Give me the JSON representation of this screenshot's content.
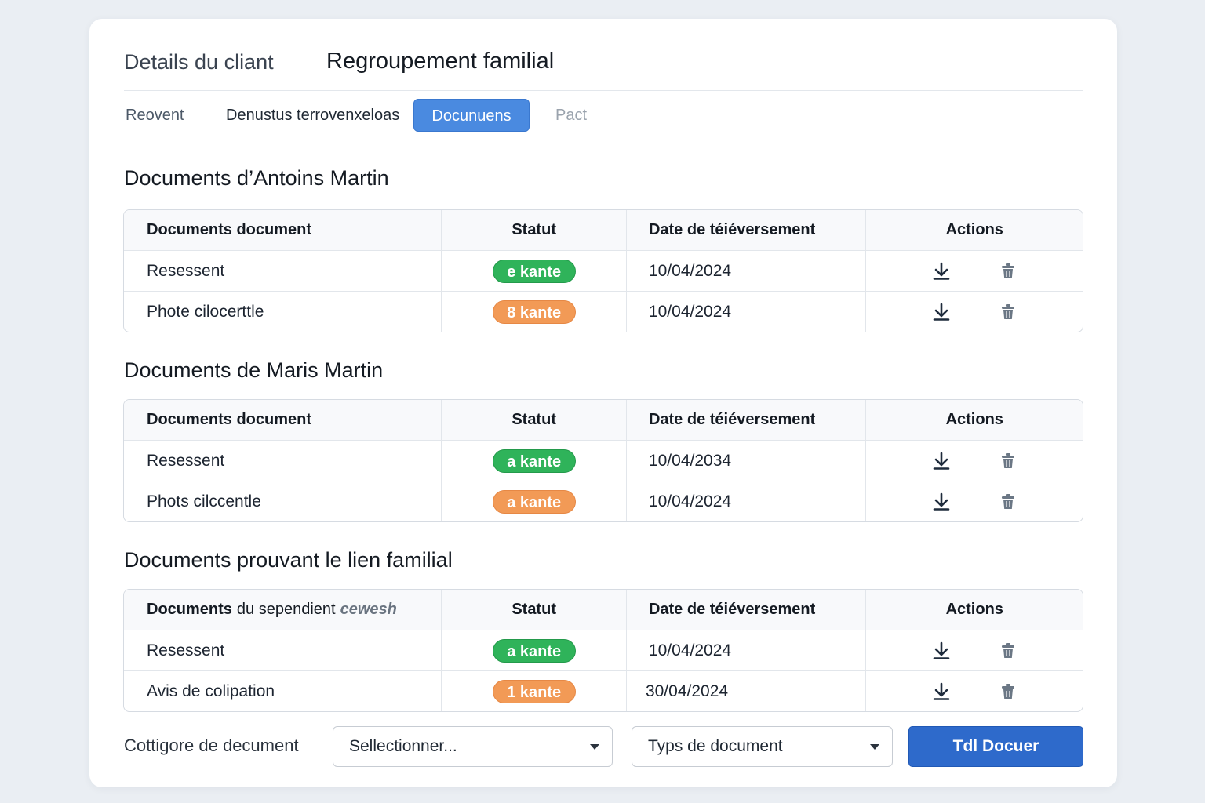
{
  "header": {
    "crumb": "Details du cliant",
    "title": "Regroupement familial"
  },
  "tabs": [
    {
      "label": "Reovent"
    },
    {
      "label": "Denustus terrovenxeloas"
    },
    {
      "label": "Docunuens",
      "active": true
    },
    {
      "label": "Pact"
    }
  ],
  "columns": {
    "document": "Documents document",
    "status": "Statut",
    "date": "Date de téiéversement",
    "actions": "Actions"
  },
  "sections": [
    {
      "title": "Documents d’Antoins Martin",
      "rows": [
        {
          "name": "Resessent",
          "status": "e kante",
          "status_color": "green",
          "date": "10/04/2024"
        },
        {
          "name": "Phote cilocerttle",
          "status": "8 kante",
          "status_color": "orange",
          "date": "10/04/2024"
        }
      ]
    },
    {
      "title": "Documents de Maris Martin",
      "rows": [
        {
          "name": "Resessent",
          "status": "a kante",
          "status_color": "green",
          "date": "10/04/2034"
        },
        {
          "name": "Phots cilccentle",
          "status": "a kante",
          "status_color": "orange",
          "date": "10/04/2024"
        }
      ]
    },
    {
      "title": "Documents prouvant le lien familial",
      "header_doc": {
        "bold": "Documents",
        "rest": "du sependient",
        "italic": "cewesh"
      },
      "rows": [
        {
          "name": "Resessent",
          "status": "a kante",
          "status_color": "green",
          "date": "10/04/2024"
        },
        {
          "name": "Avis de colipation",
          "status": "1 kante",
          "status_color": "orange",
          "date": "30/04/2024"
        }
      ]
    }
  ],
  "footer": {
    "category_label": "Cottigore de decument",
    "select_placeholder": "Sellectionner...",
    "type_select": "Typs de document",
    "submit_label": "Tdl Docuer"
  },
  "icons": {
    "download": "download-icon",
    "delete": "trash-icon",
    "dropdown": "chevron-down-icon"
  },
  "colors": {
    "accent": "#2e6acb",
    "active_tab": "#4a8ae0",
    "status_green": "#2fb35a",
    "status_orange": "#f29a56"
  }
}
